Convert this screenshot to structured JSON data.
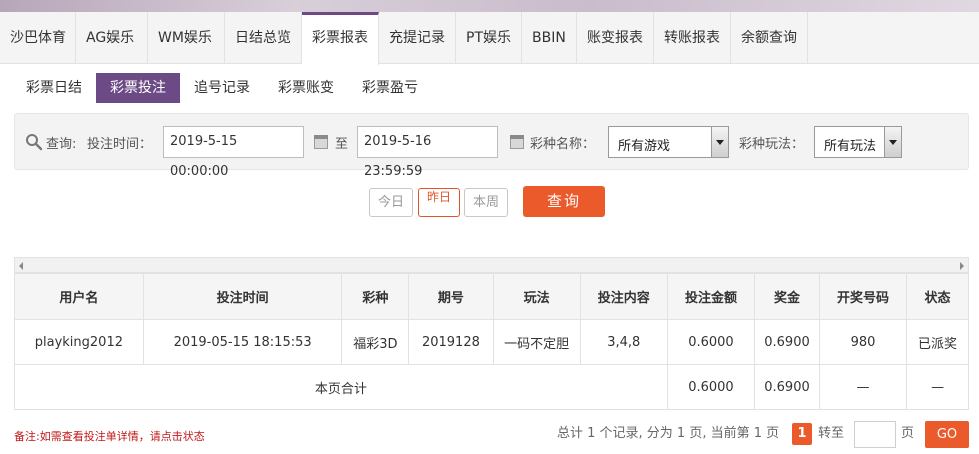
{
  "tabs": [
    {
      "label": "沙巴体育"
    },
    {
      "label": "AG娱乐"
    },
    {
      "label": "WM娱乐"
    },
    {
      "label": "日结总览"
    },
    {
      "label": "彩票报表"
    },
    {
      "label": "充提记录"
    },
    {
      "label": "PT娱乐"
    },
    {
      "label": "BBIN"
    },
    {
      "label": "账变报表"
    },
    {
      "label": "转账报表"
    },
    {
      "label": "余额查询"
    }
  ],
  "subtabs": [
    {
      "label": "彩票日结"
    },
    {
      "label": "彩票投注"
    },
    {
      "label": "追号记录"
    },
    {
      "label": "彩票账变"
    },
    {
      "label": "彩票盈亏"
    }
  ],
  "filter": {
    "query_label": "查询:",
    "time_label": "投注时间：",
    "start": "2019-5-15 00:00:00",
    "to": "至",
    "end": "2019-5-16 23:59:59",
    "game_label": "彩种名称：",
    "game_value": "所有游戏",
    "play_label": "彩种玩法：",
    "play_value": "所有玩法"
  },
  "quick": {
    "today": "今日",
    "yesterday": "昨日",
    "week": "本周",
    "search": "查询"
  },
  "table": {
    "headers": [
      "用户名",
      "投注时间",
      "彩种",
      "期号",
      "玩法",
      "投注内容",
      "投注金额",
      "奖金",
      "开奖号码",
      "状态"
    ],
    "rows": [
      [
        "playking2012",
        "2019-05-15 18:15:53",
        "福彩3D",
        "2019128",
        "一码不定胆",
        "3,4,8",
        "0.6000",
        "0.6900",
        "980",
        "已派奖"
      ]
    ],
    "total": {
      "label": "本页合计",
      "amount": "0.6000",
      "bonus": "0.6900",
      "number": "—",
      "status": "—"
    }
  },
  "footer": {
    "note": "备注:如需查看投注单详情，请点击状态",
    "summary": "总计 1 个记录, 分为 1 页, 当前第 1 页",
    "page": "1",
    "goto": "转至",
    "unit": "页",
    "go": "GO"
  },
  "colors": {
    "accent": "#6b4a86",
    "primary": "#ea5a2a",
    "status": "#e28a1a",
    "note": "#c01818"
  }
}
